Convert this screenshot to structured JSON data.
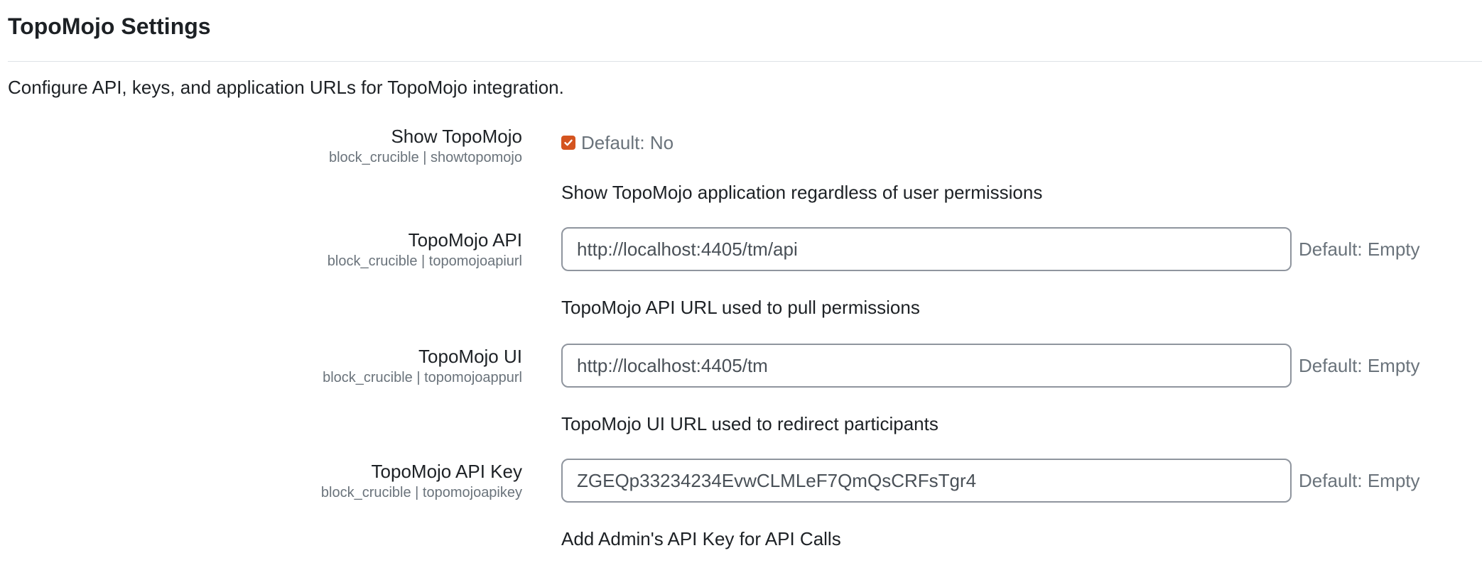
{
  "page": {
    "title": "TopoMojo Settings",
    "intro": "Configure API, keys, and application URLs for TopoMojo integration."
  },
  "settings": [
    {
      "label": "Show TopoMojo",
      "key": "block_crucible | showtopomojo",
      "type": "checkbox",
      "checked": true,
      "default": "Default: No",
      "description": "Show TopoMojo application regardless of user permissions"
    },
    {
      "label": "TopoMojo API",
      "key": "block_crucible | topomojoapiurl",
      "type": "text",
      "value": "http://localhost:4405/tm/api",
      "default": "Default: Empty",
      "description": "TopoMojo API URL used to pull permissions"
    },
    {
      "label": "TopoMojo UI",
      "key": "block_crucible | topomojoappurl",
      "type": "text",
      "value": "http://localhost:4405/tm",
      "default": "Default: Empty",
      "description": "TopoMojo UI URL used to redirect participants"
    },
    {
      "label": "TopoMojo API Key",
      "key": "block_crucible | topomojoapikey",
      "type": "text",
      "value": "ZGEQp33234234EvwCLMLeF7QmQsCRFsTgr4",
      "default": "Default: Empty",
      "description": "Add Admin's API Key for API Calls"
    }
  ],
  "colors": {
    "checkbox_accent": "#d4541f",
    "text_primary": "#1d2125",
    "text_muted": "#6a737b",
    "input_border": "#8f959e"
  }
}
